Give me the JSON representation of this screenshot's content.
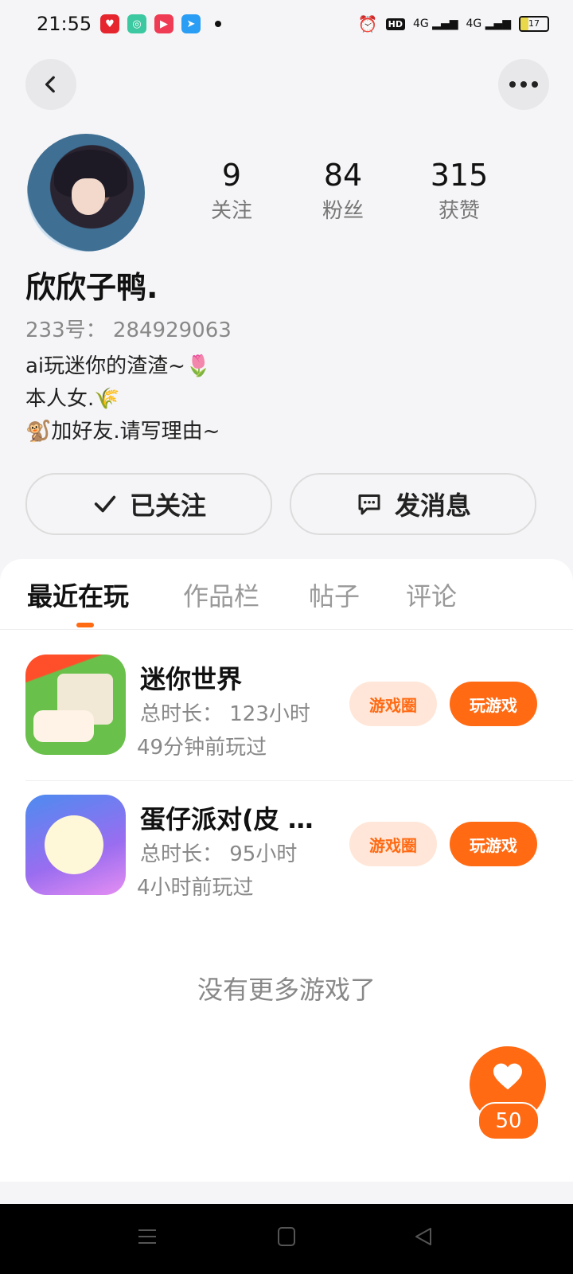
{
  "status_bar": {
    "time": "21:55",
    "network": "4G",
    "battery": "17",
    "hd": "HD"
  },
  "profile": {
    "stats": [
      {
        "value": "9",
        "label": "关注"
      },
      {
        "value": "84",
        "label": "粉丝"
      },
      {
        "value": "315",
        "label": "获赞"
      }
    ],
    "nickname": "欣欣子鸭.",
    "uid_label": "233号：",
    "uid": "284929063",
    "bio": [
      "ai玩迷你的渣渣~🌷",
      "本人女.🌾",
      "🐒加好友.请写理由~"
    ]
  },
  "actions": {
    "follow_label": "已关注",
    "message_label": "发消息"
  },
  "tabs": [
    "最近在玩",
    "作品栏",
    "帖子",
    "评论"
  ],
  "games": [
    {
      "name": "迷你世界",
      "playtime": "总时长： 123小时",
      "last_played": "49分钟前玩过",
      "circle_label": "游戏圈",
      "play_label": "玩游戏"
    },
    {
      "name": "蛋仔派对(皮 …",
      "playtime": "总时长： 95小时",
      "last_played": "4小时前玩过",
      "circle_label": "游戏圈",
      "play_label": "玩游戏"
    }
  ],
  "no_more_text": "没有更多游戏了",
  "like_count": "50",
  "colors": {
    "accent": "#ff6a13",
    "accent_light": "#ffe6d8"
  }
}
